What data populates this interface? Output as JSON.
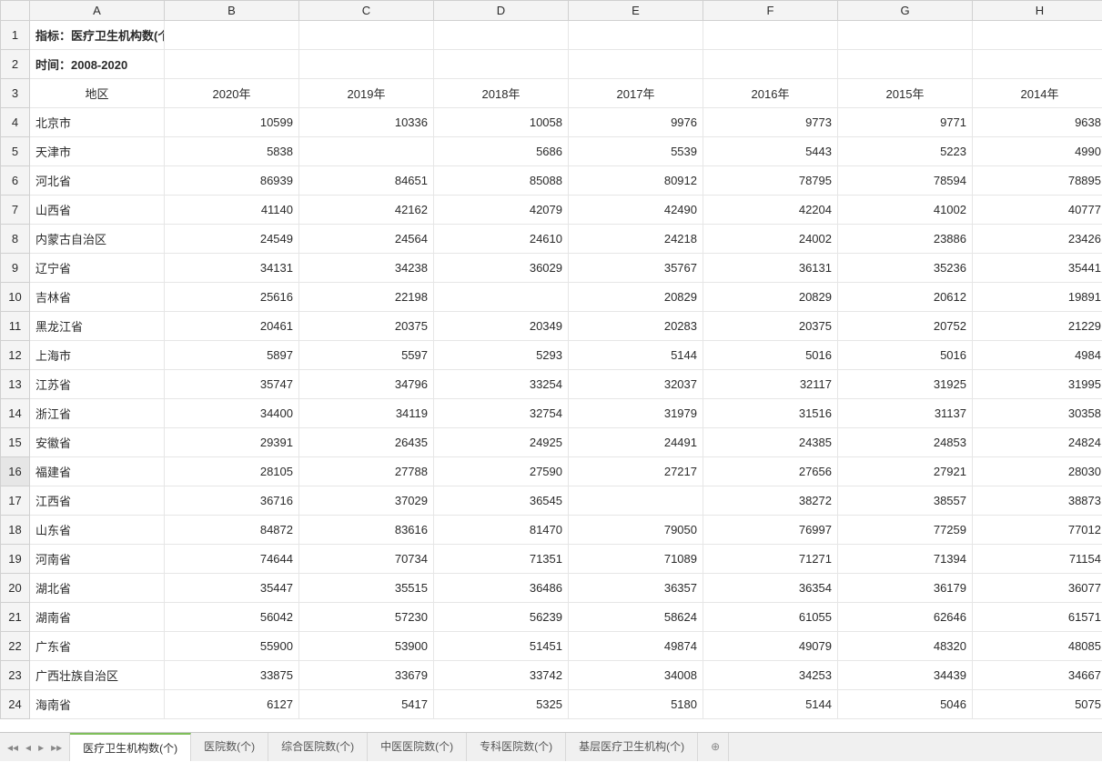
{
  "columns": [
    "A",
    "B",
    "C",
    "D",
    "E",
    "F",
    "G",
    "H"
  ],
  "title_row": {
    "text": "指标：医疗卫生机构数(个)"
  },
  "time_row": {
    "text": "时间：2008-2020"
  },
  "header_row": [
    "地区",
    "2020年",
    "2019年",
    "2018年",
    "2017年",
    "2016年",
    "2015年",
    "2014年"
  ],
  "selected_row_header": 16,
  "rows": [
    {
      "r": 4,
      "region": "北京市",
      "v": [
        "10599",
        "10336",
        "10058",
        "9976",
        "9773",
        "9771",
        "9638"
      ]
    },
    {
      "r": 5,
      "region": "天津市",
      "v": [
        "5838",
        "",
        "5686",
        "5539",
        "5443",
        "5223",
        "4990"
      ]
    },
    {
      "r": 6,
      "region": "河北省",
      "v": [
        "86939",
        "84651",
        "85088",
        "80912",
        "78795",
        "78594",
        "78895"
      ]
    },
    {
      "r": 7,
      "region": "山西省",
      "v": [
        "41140",
        "42162",
        "42079",
        "42490",
        "42204",
        "41002",
        "40777"
      ]
    },
    {
      "r": 8,
      "region": "内蒙古自治区",
      "v": [
        "24549",
        "24564",
        "24610",
        "24218",
        "24002",
        "23886",
        "23426"
      ]
    },
    {
      "r": 9,
      "region": "辽宁省",
      "v": [
        "34131",
        "34238",
        "36029",
        "35767",
        "36131",
        "35236",
        "35441"
      ]
    },
    {
      "r": 10,
      "region": "吉林省",
      "v": [
        "25616",
        "22198",
        "",
        "20829",
        "20829",
        "20612",
        "19891"
      ]
    },
    {
      "r": 11,
      "region": "黑龙江省",
      "v": [
        "20461",
        "20375",
        "20349",
        "20283",
        "20375",
        "20752",
        "21229"
      ]
    },
    {
      "r": 12,
      "region": "上海市",
      "v": [
        "5897",
        "5597",
        "5293",
        "5144",
        "5016",
        "5016",
        "4984"
      ]
    },
    {
      "r": 13,
      "region": "江苏省",
      "v": [
        "35747",
        "34796",
        "33254",
        "32037",
        "32117",
        "31925",
        "31995"
      ]
    },
    {
      "r": 14,
      "region": "浙江省",
      "v": [
        "34400",
        "34119",
        "32754",
        "31979",
        "31516",
        "31137",
        "30358"
      ]
    },
    {
      "r": 15,
      "region": "安徽省",
      "v": [
        "29391",
        "26435",
        "24925",
        "24491",
        "24385",
        "24853",
        "24824"
      ]
    },
    {
      "r": 16,
      "region": "福建省",
      "v": [
        "28105",
        "27788",
        "27590",
        "27217",
        "27656",
        "27921",
        "28030"
      ]
    },
    {
      "r": 17,
      "region": "江西省",
      "v": [
        "36716",
        "37029",
        "36545",
        "",
        "38272",
        "38557",
        "38873"
      ]
    },
    {
      "r": 18,
      "region": "山东省",
      "v": [
        "84872",
        "83616",
        "81470",
        "79050",
        "76997",
        "77259",
        "77012"
      ]
    },
    {
      "r": 19,
      "region": "河南省",
      "v": [
        "74644",
        "70734",
        "71351",
        "71089",
        "71271",
        "71394",
        "71154"
      ]
    },
    {
      "r": 20,
      "region": "湖北省",
      "v": [
        "35447",
        "35515",
        "36486",
        "36357",
        "36354",
        "36179",
        "36077"
      ]
    },
    {
      "r": 21,
      "region": "湖南省",
      "v": [
        "56042",
        "57230",
        "56239",
        "58624",
        "61055",
        "62646",
        "61571"
      ]
    },
    {
      "r": 22,
      "region": "广东省",
      "v": [
        "55900",
        "53900",
        "51451",
        "49874",
        "49079",
        "48320",
        "48085"
      ]
    },
    {
      "r": 23,
      "region": "广西壮族自治区",
      "v": [
        "33875",
        "33679",
        "33742",
        "34008",
        "34253",
        "34439",
        "34667"
      ]
    },
    {
      "r": 24,
      "region": "海南省",
      "v": [
        "6127",
        "5417",
        "5325",
        "5180",
        "5144",
        "5046",
        "5075"
      ]
    }
  ],
  "tabs": {
    "items": [
      {
        "label": "医疗卫生机构数(个)",
        "active": true
      },
      {
        "label": "医院数(个)"
      },
      {
        "label": "综合医院数(个)"
      },
      {
        "label": "中医医院数(个)"
      },
      {
        "label": "专科医院数(个)"
      },
      {
        "label": "基层医疗卫生机构(个)"
      }
    ],
    "nav": {
      "first": "◂◂",
      "prev": "◂",
      "next": "▸",
      "last": "▸▸"
    },
    "add_icon": "⊕"
  }
}
